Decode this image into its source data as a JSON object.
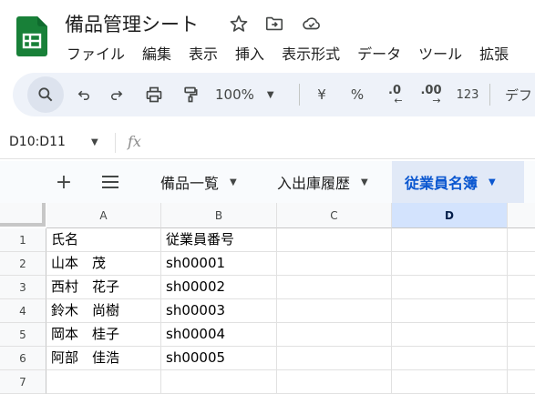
{
  "app": {
    "title": "備品管理シート",
    "menu": [
      "ファイル",
      "編集",
      "表示",
      "挿入",
      "表示形式",
      "データ",
      "ツール",
      "拡張"
    ]
  },
  "toolbar": {
    "zoom": "100%",
    "currency": "¥",
    "percent": "%",
    "decrease_decimal": ".0",
    "increase_decimal": ".00",
    "number_format": "123",
    "font_partial": "デフ"
  },
  "formula_bar": {
    "name_box": "D10:D11",
    "fx_label": "fx"
  },
  "sheets": {
    "add_label": "+",
    "tabs": [
      "備品一覧",
      "入出庫履歴",
      "従業員名簿"
    ],
    "active": "従業員名簿"
  },
  "grid": {
    "columns": [
      "A",
      "B",
      "C",
      "D"
    ],
    "selected_column": "D",
    "rows": [
      {
        "num": "1",
        "a": "氏名",
        "b": "従業員番号"
      },
      {
        "num": "2",
        "a": "山本　茂",
        "b": "sh00001"
      },
      {
        "num": "3",
        "a": "西村　花子",
        "b": "sh00002"
      },
      {
        "num": "4",
        "a": "鈴木　尚樹",
        "b": "sh00003"
      },
      {
        "num": "5",
        "a": "岡本　桂子",
        "b": "sh00004"
      },
      {
        "num": "6",
        "a": "阿部　佳浩",
        "b": "sh00005"
      },
      {
        "num": "7",
        "a": "",
        "b": ""
      }
    ]
  },
  "colors": {
    "accent": "#0b57d0",
    "sheets_green": "#188038",
    "toolbar_bg": "#eef2f9",
    "selected_header": "#d3e3fd"
  }
}
